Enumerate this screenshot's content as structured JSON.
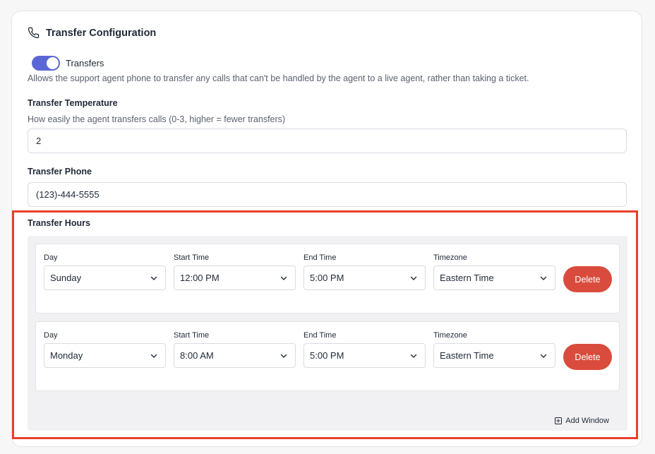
{
  "card": {
    "title": "Transfer Configuration",
    "icon": "phone-icon"
  },
  "transfers": {
    "label": "Transfers",
    "enabled": true,
    "description": "Allows the support agent phone to transfer any calls that can't be handled by the agent to a live agent, rather than taking a ticket."
  },
  "temperature": {
    "label": "Transfer Temperature",
    "help": "How easily the agent transfers calls (0-3, higher = fewer transfers)",
    "value": "2"
  },
  "phone": {
    "label": "Transfer Phone",
    "value": "(123)-444-5555"
  },
  "hours": {
    "label": "Transfer Hours",
    "columns": {
      "day": "Day",
      "start": "Start Time",
      "end": "End Time",
      "timezone": "Timezone"
    },
    "delete_label": "Delete",
    "add_label": "Add Window",
    "windows": [
      {
        "day": "Sunday",
        "start": "12:00 PM",
        "end": "5:00 PM",
        "timezone": "Eastern Time"
      },
      {
        "day": "Monday",
        "start": "8:00 AM",
        "end": "5:00 PM",
        "timezone": "Eastern Time"
      }
    ]
  },
  "colors": {
    "toggle_on": "#5a66d6",
    "delete": "#d94c3d",
    "highlight": "#e8402a"
  }
}
